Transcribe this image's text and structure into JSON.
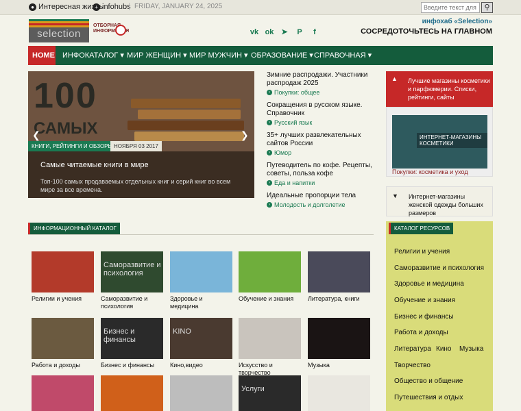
{
  "topbar": {
    "link1": "Интересная жизнь",
    "link2": "infohubs",
    "date": "FRIDAY, JANUARY 24, 2025",
    "search_placeholder": "Введите текст для п",
    "search_icon": "search-icon"
  },
  "header": {
    "logo_text": "selection",
    "logo_sub": "ОТБОРНАЯ ИНФОРМАЦИЯ",
    "hub_title": "инфохаб «Selection»",
    "tagline": "СОСРЕДОТОЧЬТЕСЬ НА ГЛАВНОМ",
    "socials": [
      {
        "icon": "vk-icon",
        "glyph": "vk"
      },
      {
        "icon": "ok-icon",
        "glyph": "ok"
      },
      {
        "icon": "telegram-icon",
        "glyph": "➤"
      },
      {
        "icon": "pinterest-icon",
        "glyph": "P"
      },
      {
        "icon": "facebook-icon",
        "glyph": "f"
      }
    ]
  },
  "nav": {
    "items": [
      "HOME",
      "ИНФОКАТАЛОГ ▾",
      "МИР ЖЕНЩИН ▾",
      "МИР МУЖЧИН ▾",
      "ОБРАЗОВАНИЕ ▾",
      "СПРАВОЧНАЯ ▾"
    ]
  },
  "slider": {
    "big_text": "100",
    "big_text2": "САМЫХ",
    "tag": "КНИГИ, РЕЙТИНГИ И ОБЗОРЫ",
    "date": "НОЯБРЯ 03 2017",
    "title": "Самые читаемые книги в мире",
    "desc": "Топ-100 самых продаваемых отдельных книг и серий книг во всем мире за все времена.",
    "prev": "❮",
    "next": "❯"
  },
  "news": [
    {
      "title": "Зимние распродажи. Участники распродаж 2025",
      "cat": "Покупки: общее"
    },
    {
      "title": "Сокращения в русском языке. Справочник",
      "cat": "Русский язык"
    },
    {
      "title": "35+ лучших развлекательных сайтов России",
      "cat": "Юмор"
    },
    {
      "title": "Путеводитель по кофе. Рецепты, советы, польза кофе",
      "cat": "Еда и напитки"
    },
    {
      "title": "Идеальные пропорции тела",
      "cat": "Молодость и долголетие"
    }
  ],
  "catalog": {
    "title": "ИНФОРМАЦИОННЫЙ КАТАЛОГ",
    "tiles": [
      {
        "label": "Религии и учения",
        "color": "#b33a2a",
        "text": ""
      },
      {
        "label": "Саморазвитие и психология",
        "color": "#2f4a2f",
        "text": "Саморазвитие и психология"
      },
      {
        "label": "Здоровье и медицина",
        "color": "#7ab5d9",
        "text": ""
      },
      {
        "label": "Обучение и знания",
        "color": "#6fae3c",
        "text": ""
      },
      {
        "label": "Литература, книги",
        "color": "#4a4a5a",
        "text": ""
      },
      {
        "label": "Работа и доходы",
        "color": "#6b5a40",
        "text": ""
      },
      {
        "label": "Бизнес и финансы",
        "color": "#2a2a2a",
        "text": "Бизнес и финансы"
      },
      {
        "label": "Кино,видео",
        "color": "#4a3a30",
        "text": "KINO"
      },
      {
        "label": "Искусство и творчество",
        "color": "#c9c4bd",
        "text": ""
      },
      {
        "label": "Музыка",
        "color": "#1a1414",
        "text": ""
      },
      {
        "label": "",
        "color": "#c04a6a",
        "text": ""
      },
      {
        "label": "",
        "color": "#d0601a",
        "text": ""
      },
      {
        "label": "",
        "color": "#bdbdbd",
        "text": ""
      },
      {
        "label": "",
        "color": "#2a2a2a",
        "text": "Услуги"
      },
      {
        "label": "",
        "color": "#e9e7e0",
        "text": ""
      }
    ]
  },
  "sidebar": {
    "ad_text": "Лучшие магазины косметики и парфюмерии. Списки, рейтинги, сайты",
    "ad_img_text": "ИНТЕРНЕТ-МАГАЗИНЫ КОСМЕТИКИ",
    "ad_caption": "Покупки: косметика и уход",
    "ad2_text": "Интернет-магазины женской одежды больших размеров",
    "catalog_title": "КАТАЛОГ РЕСУРСОВ",
    "catalog_items": [
      "Религии и учения",
      "Саморазвитие и психология",
      "Здоровье и медицина",
      "Обучение и знания",
      "Бизнес и финансы",
      "Работа и доходы",
      "Литература",
      "Кино",
      "Музыка",
      "Творчество",
      "Общество и общение",
      "Путешествия и отдых"
    ]
  }
}
